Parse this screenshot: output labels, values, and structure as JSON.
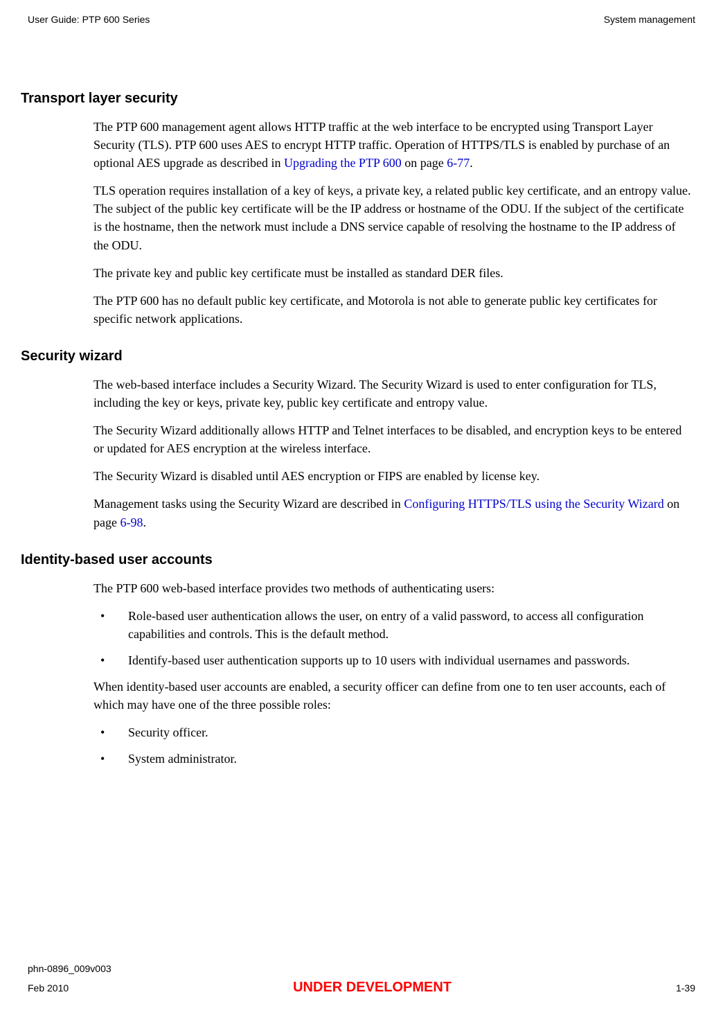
{
  "header": {
    "left": "User Guide: PTP 600 Series",
    "right": "System management"
  },
  "section1": {
    "heading": "Transport layer security",
    "p1_before": "The PTP 600 management agent allows HTTP traffic at the web interface to be encrypted using Transport Layer Security (TLS). PTP 600 uses AES to encrypt HTTP traffic. Operation of HTTPS/TLS is enabled by purchase of an optional AES upgrade as described in ",
    "p1_link": "Upgrading the PTP 600",
    "p1_mid": " on page ",
    "p1_page": "6-77",
    "p1_after": ".",
    "p2": "TLS operation requires installation of a key of keys, a private key, a related public key certificate, and an entropy value. The subject of the public key certificate will be the IP address or hostname of the ODU. If the subject of the certificate is the hostname, then the network must include a DNS service capable of resolving the hostname to the IP address of the ODU.",
    "p3": "The private key and public key certificate must be installed as standard DER files.",
    "p4": "The PTP 600 has no default public key certificate, and Motorola is not able to generate public key certificates for specific network applications."
  },
  "section2": {
    "heading": "Security wizard",
    "p1": "The web-based interface includes a Security Wizard. The Security Wizard is used to enter configuration for TLS, including the key or keys, private key, public key certificate and entropy value.",
    "p2": "The Security Wizard additionally allows HTTP and Telnet interfaces to be disabled, and encryption keys to be entered or updated for AES encryption at the wireless interface.",
    "p3": "The Security Wizard is disabled until AES encryption or FIPS are enabled by license key.",
    "p4_before": "Management tasks using the Security Wizard are described in ",
    "p4_link": "Configuring HTTPS/TLS using the Security Wizard",
    "p4_mid": " on page ",
    "p4_page": "6-98",
    "p4_after": "."
  },
  "section3": {
    "heading": "Identity-based user accounts",
    "p1": "The PTP 600 web-based interface provides two methods of authenticating users:",
    "bullets1": [
      "Role-based user authentication allows the user, on entry of a valid password, to access all configuration capabilities and controls. This is the default method.",
      "Identify-based user authentication supports up to 10 users with individual usernames and passwords."
    ],
    "p2": "When identity-based user accounts are enabled, a security officer can define from one to ten user accounts, each of which may have one of the three possible roles:",
    "bullets2": [
      "Security officer.",
      "System administrator."
    ]
  },
  "footer": {
    "doc_id": "phn-0896_009v003",
    "date": "Feb 2010",
    "status": "UNDER DEVELOPMENT",
    "page": "1-39"
  }
}
